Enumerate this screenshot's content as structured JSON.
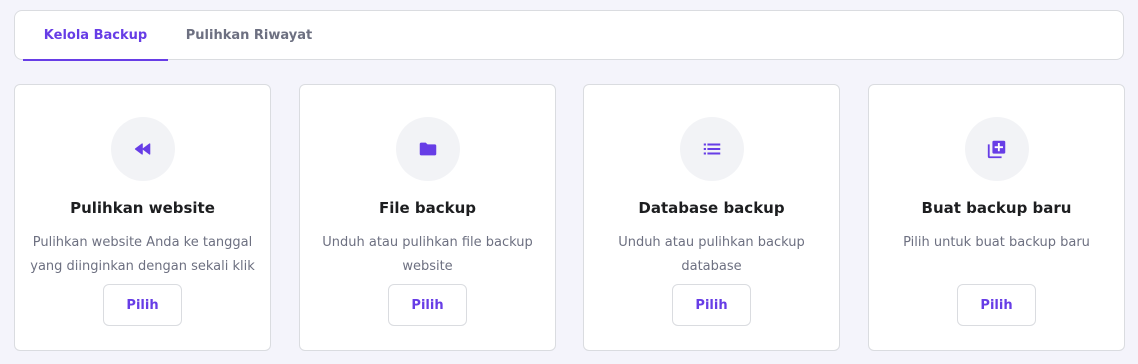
{
  "colors": {
    "accent": "#673de6",
    "muted_text": "#6d7081",
    "heading_text": "#1d1e20",
    "icon_bg": "#f2f3f6",
    "page_bg": "#f4f4fb"
  },
  "tabs": [
    {
      "label": "Kelola Backup",
      "active": true
    },
    {
      "label": "Pulihkan Riwayat",
      "active": false
    }
  ],
  "cards": [
    {
      "icon": "rewind-icon",
      "title": "Pulihkan website",
      "description": "Pulihkan website Anda ke tanggal yang diinginkan dengan sekali klik",
      "button_label": "Pilih"
    },
    {
      "icon": "folder-icon",
      "title": "File backup",
      "description": "Unduh atau pulihkan file backup website",
      "button_label": "Pilih"
    },
    {
      "icon": "list-icon",
      "title": "Database backup",
      "description": "Unduh atau pulihkan backup database",
      "button_label": "Pilih"
    },
    {
      "icon": "add-box-icon",
      "title": "Buat backup baru",
      "description": "Pilih untuk buat backup baru",
      "button_label": "Pilih"
    }
  ]
}
